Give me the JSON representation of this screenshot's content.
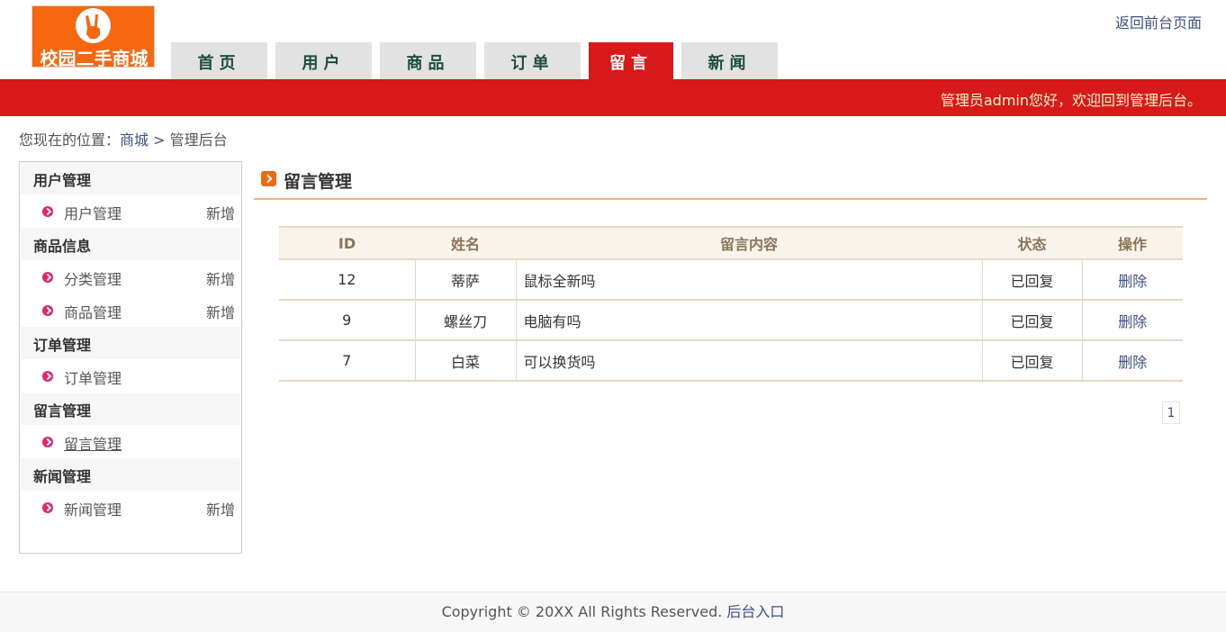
{
  "header": {
    "logo_text": "校园二手商城",
    "back_link": "返回前台页面",
    "welcome": "管理员admin您好，欢迎回到管理后台。"
  },
  "nav": {
    "tabs": [
      {
        "label": "首页",
        "active": false
      },
      {
        "label": "用户",
        "active": false
      },
      {
        "label": "商品",
        "active": false
      },
      {
        "label": "订单",
        "active": false
      },
      {
        "label": "留言",
        "active": true
      },
      {
        "label": "新闻",
        "active": false
      }
    ]
  },
  "breadcrumb": {
    "prefix": "您现在的位置：",
    "home": "商城",
    "sep": " > ",
    "current": "管理后台"
  },
  "sidebar": {
    "groups": [
      {
        "title": "用户管理",
        "items": [
          {
            "label": "用户管理",
            "add": "新增"
          }
        ]
      },
      {
        "title": "商品信息",
        "items": [
          {
            "label": "分类管理",
            "add": "新增"
          },
          {
            "label": "商品管理",
            "add": "新增"
          }
        ]
      },
      {
        "title": "订单管理",
        "items": [
          {
            "label": "订单管理",
            "add": ""
          }
        ]
      },
      {
        "title": "留言管理",
        "items": [
          {
            "label": "留言管理",
            "add": ""
          }
        ]
      },
      {
        "title": "新闻管理",
        "items": [
          {
            "label": "新闻管理",
            "add": "新增"
          }
        ]
      }
    ]
  },
  "main": {
    "title": "留言管理",
    "table": {
      "headers": [
        "ID",
        "姓名",
        "留言内容",
        "状态",
        "操作"
      ],
      "rows": [
        {
          "id": "12",
          "name": "蒂萨",
          "content": "鼠标全新吗",
          "status": "已回复",
          "action": "删除"
        },
        {
          "id": "9",
          "name": "螺丝刀",
          "content": "电脑有吗",
          "status": "已回复",
          "action": "删除"
        },
        {
          "id": "7",
          "name": "白菜",
          "content": "可以换货吗",
          "status": "已回复",
          "action": "删除"
        }
      ]
    },
    "pager": {
      "current": "1"
    }
  },
  "footer": {
    "copyright": "Copyright © 20XX All Rights Reserved. ",
    "admin_link": "后台入口"
  },
  "colors": {
    "accent_red": "#d7191a",
    "logo_orange": "#f7670f",
    "link_blue": "#3c4f88",
    "bullet_pink": "#e8236d"
  }
}
